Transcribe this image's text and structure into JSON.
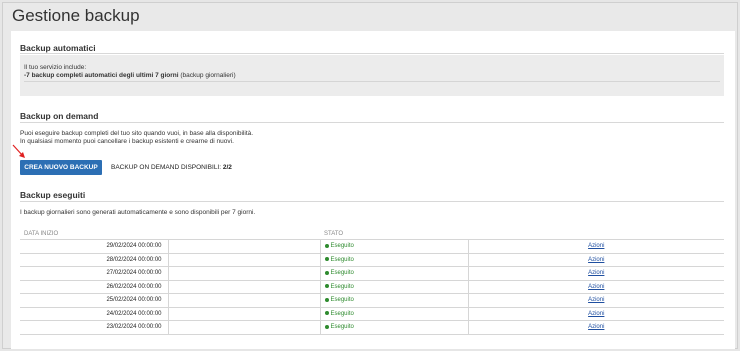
{
  "page_title": "Gestione backup",
  "auto": {
    "title": "Backup automatici",
    "line1": "Il tuo servizio include:",
    "line2_bold": "-7 backup completi automatici degli ultimi 7 giorni",
    "line2_rest": " (backup giornalieri)"
  },
  "ondemand": {
    "title": "Backup on demand",
    "text1": "Puoi eseguire backup completi del tuo sito quando vuoi, in base alla disponibilità.",
    "text2": "In qualsiasi momento puoi cancellare i backup esistenti e crearne di nuovi.",
    "button_label": "CREA NUOVO BACKUP",
    "available_label": "BACKUP ON DEMAND DISPONIBILI: ",
    "available_value": "2/2"
  },
  "done": {
    "title": "Backup eseguiti",
    "text": "I backup giornalieri sono generati automaticamente e sono disponibili per 7 giorni.",
    "columns": [
      "DATA INIZIO",
      "",
      "STATO",
      ""
    ],
    "rows": [
      {
        "date": "29/02/2024 00:00:00",
        "status": "Eseguito",
        "action": "Azioni"
      },
      {
        "date": "28/02/2024 00:00:00",
        "status": "Eseguito",
        "action": "Azioni"
      },
      {
        "date": "27/02/2024 00:00:00",
        "status": "Eseguito",
        "action": "Azioni"
      },
      {
        "date": "26/02/2024 00:00:00",
        "status": "Eseguito",
        "action": "Azioni"
      },
      {
        "date": "25/02/2024 00:00:00",
        "status": "Eseguito",
        "action": "Azioni"
      },
      {
        "date": "24/02/2024 00:00:00",
        "status": "Eseguito",
        "action": "Azioni"
      },
      {
        "date": "23/02/2024 00:00:00",
        "status": "Eseguito",
        "action": "Azioni"
      }
    ]
  },
  "colors": {
    "accent": "#2c6fb4",
    "success": "#2e8b2e",
    "link": "#1f4fa0",
    "arrow": "#e02020"
  },
  "icons": {
    "annotation": "red-arrow-icon",
    "status": "status-dot-icon"
  }
}
